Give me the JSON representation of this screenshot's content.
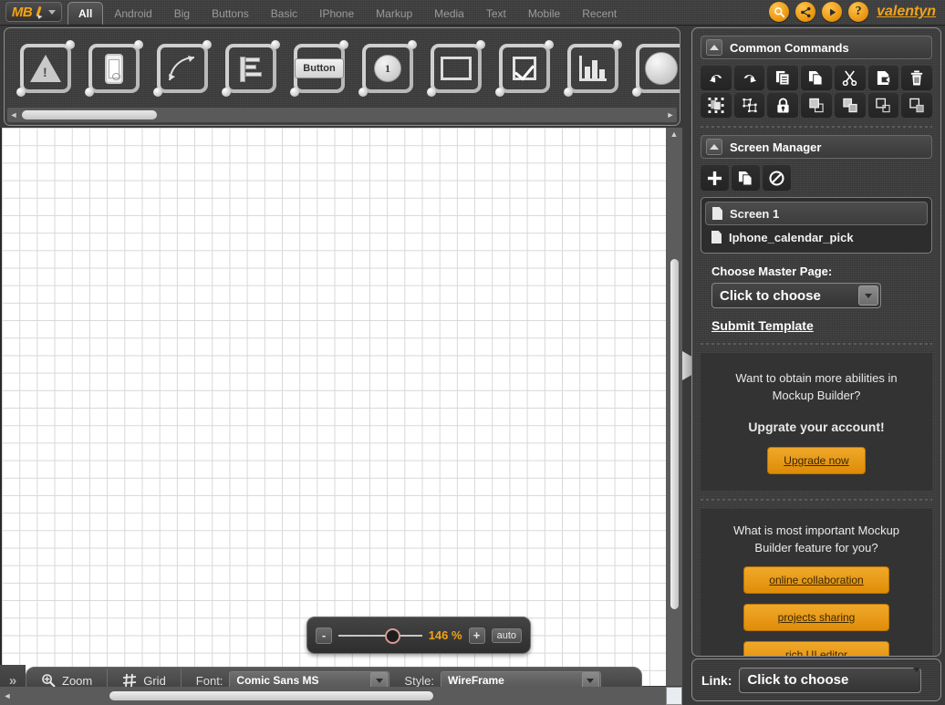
{
  "app": {
    "logo_text": "MB",
    "username": "valentyn"
  },
  "topbar": {
    "tabs": [
      {
        "label": "All",
        "active": true
      },
      {
        "label": "Android",
        "active": false
      },
      {
        "label": "Big",
        "active": false
      },
      {
        "label": "Buttons",
        "active": false
      },
      {
        "label": "Basic",
        "active": false
      },
      {
        "label": "IPhone",
        "active": false
      },
      {
        "label": "Markup",
        "active": false
      },
      {
        "label": "Media",
        "active": false
      },
      {
        "label": "Text",
        "active": false
      },
      {
        "label": "Mobile",
        "active": false
      },
      {
        "label": "Recent",
        "active": false
      }
    ],
    "actions": [
      {
        "name": "search-icon",
        "title": "Search"
      },
      {
        "name": "share-icon",
        "title": "Share"
      },
      {
        "name": "play-icon",
        "title": "Preview"
      },
      {
        "name": "help-icon",
        "title": "Help"
      }
    ]
  },
  "palette": {
    "stencils": [
      {
        "name": "alert-stencil",
        "label": "Alert"
      },
      {
        "name": "phone-stencil",
        "label": "Phone"
      },
      {
        "name": "curved-arrow-stencil",
        "label": "Curved Arrow"
      },
      {
        "name": "list-stencil",
        "label": "List"
      },
      {
        "name": "button-stencil",
        "label": "Button"
      },
      {
        "name": "numbered-marker-stencil",
        "label": "1"
      },
      {
        "name": "rectangle-stencil",
        "label": "Rectangle"
      },
      {
        "name": "checkbox-stencil",
        "label": "Checkbox"
      },
      {
        "name": "bar-chart-stencil",
        "label": "Chart"
      },
      {
        "name": "circle-stencil",
        "label": "Circle"
      }
    ],
    "button_stencil_text": "Button",
    "number_stencil_text": "1"
  },
  "canvas": {
    "zoom": {
      "minus_label": "-",
      "plus_label": "+",
      "percent": "146 %",
      "auto_label": "auto"
    }
  },
  "bottombar": {
    "expand_label": "»",
    "zoom_label": "Zoom",
    "grid_label": "Grid",
    "font_label": "Font:",
    "font_value": "Comic Sans MS",
    "style_label": "Style:",
    "style_value": "WireFrame"
  },
  "right_panel": {
    "common_commands": {
      "title": "Common Commands",
      "buttons": [
        {
          "name": "undo-button",
          "label": "Undo"
        },
        {
          "name": "redo-button",
          "label": "Redo"
        },
        {
          "name": "copy-button",
          "label": "Copy"
        },
        {
          "name": "duplicate-button",
          "label": "Duplicate"
        },
        {
          "name": "cut-button",
          "label": "Cut"
        },
        {
          "name": "paste-button",
          "label": "Paste"
        },
        {
          "name": "delete-button",
          "label": "Delete"
        },
        {
          "name": "group-button",
          "label": "Group"
        },
        {
          "name": "ungroup-button",
          "label": "Ungroup"
        },
        {
          "name": "lock-button",
          "label": "Lock"
        },
        {
          "name": "bring-to-front-button",
          "label": "Bring to Front"
        },
        {
          "name": "bring-forward-button",
          "label": "Bring Forward"
        },
        {
          "name": "send-backward-button",
          "label": "Send Backward"
        },
        {
          "name": "send-to-back-button",
          "label": "Send to Back"
        }
      ]
    },
    "screen_manager": {
      "title": "Screen Manager",
      "tools": [
        {
          "name": "add-screen-button",
          "label": "Add"
        },
        {
          "name": "duplicate-screen-button",
          "label": "Duplicate"
        },
        {
          "name": "delete-screen-button",
          "label": "Delete"
        }
      ],
      "screens": [
        {
          "label": "Screen 1",
          "selected": true
        },
        {
          "label": "Iphone_calendar_pick",
          "selected": false
        }
      ],
      "master_page_label": "Choose Master Page:",
      "master_page_value": "Click to choose",
      "submit_template_label": "Submit Template"
    },
    "promo": {
      "line1": "Want to obtain more abilities in Mockup Builder?",
      "line2": "Upgrate your account!",
      "button_label": "Upgrade now"
    },
    "survey": {
      "question": "What is most important Mockup Builder feature for you?",
      "options": [
        {
          "label": "online collaboration"
        },
        {
          "label": "projects sharing"
        },
        {
          "label": "rich UI editor"
        }
      ]
    },
    "link": {
      "label": "Link:",
      "value": "Click to choose"
    }
  },
  "colors": {
    "accent": "#f0a31a",
    "panel_bg": "#3b3b3b",
    "canvas_bg": "#ffffff",
    "grid_line": "#d8d8d8"
  }
}
